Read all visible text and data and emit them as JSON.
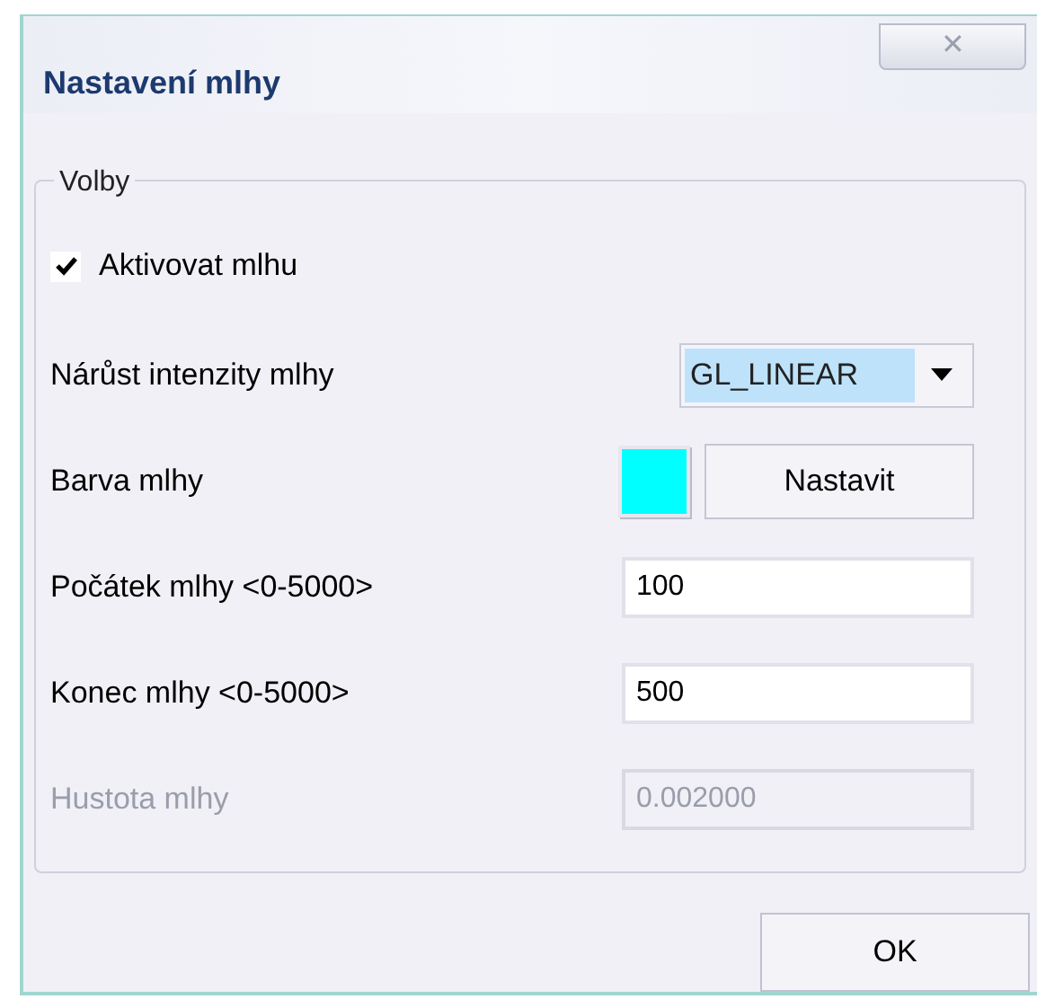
{
  "window": {
    "title": "Nastavení mlhy",
    "close": "✕"
  },
  "group": {
    "title": "Volby"
  },
  "rows": [
    {
      "kind": "checkbox",
      "label": "Aktivovat mlhu",
      "checked": true
    },
    {
      "kind": "dropdown",
      "label": "Nárůst intenzity mlhy",
      "value": "GL_LINEAR",
      "selected": true
    },
    {
      "kind": "color",
      "label": "Barva mlhy",
      "color": "#00ffff",
      "button": "Nastavit"
    },
    {
      "kind": "field",
      "label": "Počátek mlhy <0-5000>",
      "value": "100",
      "disabled": false
    },
    {
      "kind": "field",
      "label": "Konec mlhy <0-5000>",
      "value": "500",
      "disabled": false
    },
    {
      "kind": "field",
      "label": "Hustota mlhy",
      "value": "0.002000",
      "disabled": true
    }
  ],
  "buttons": [
    "OK"
  ]
}
